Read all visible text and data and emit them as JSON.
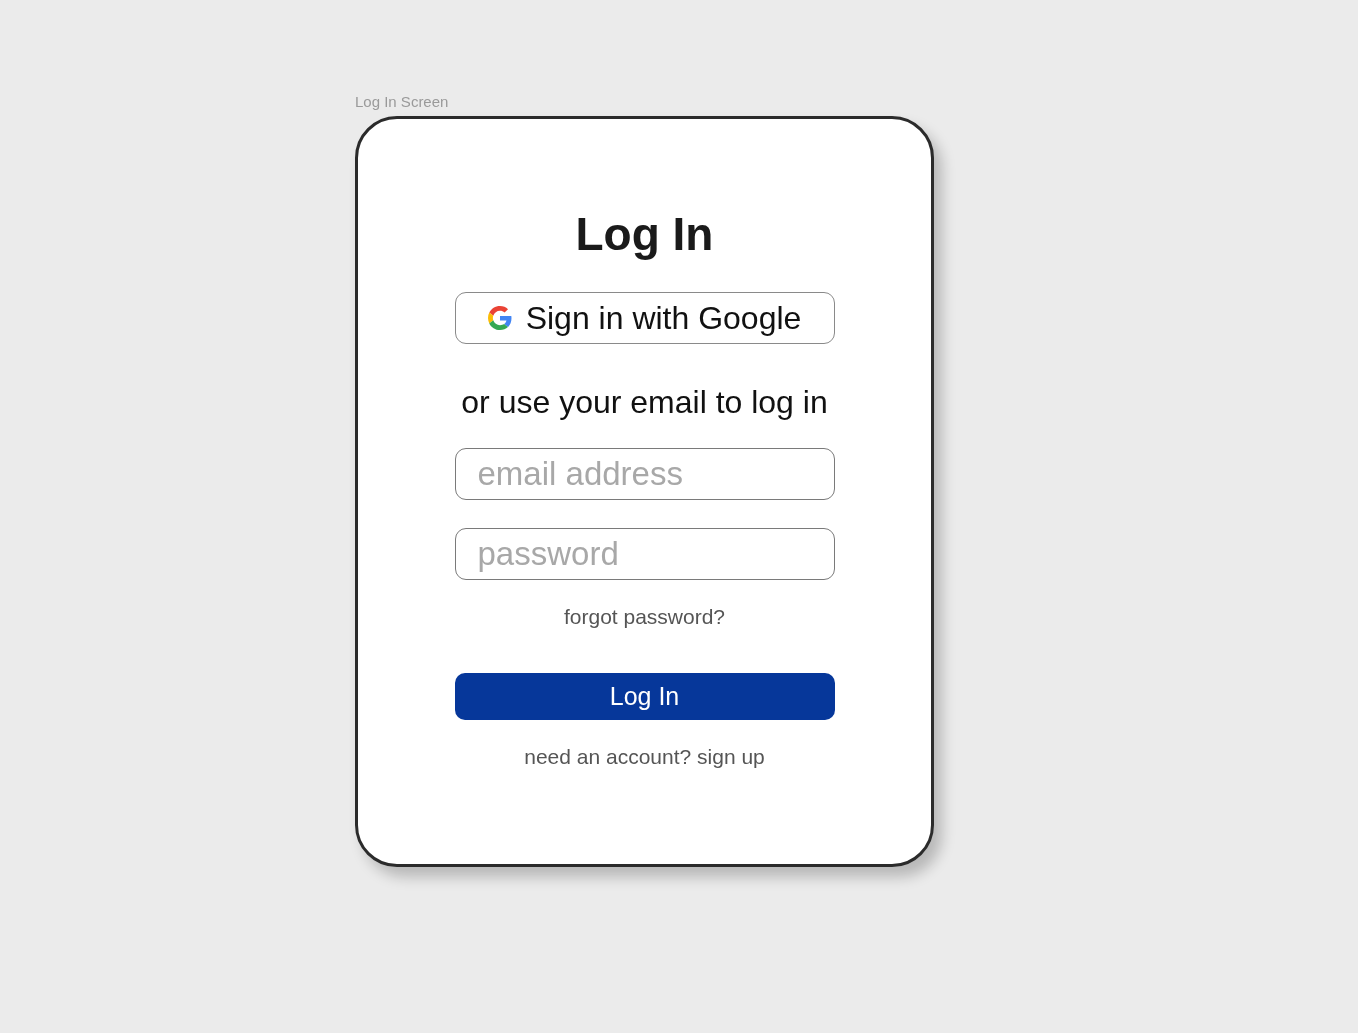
{
  "frame": {
    "label": "Log In Screen"
  },
  "card": {
    "title": "Log In",
    "google_button": {
      "label": "Sign in with Google"
    },
    "divider_text": "or use your email to log in",
    "fields": [
      {
        "placeholder": "email address"
      },
      {
        "placeholder": "password"
      }
    ],
    "forgot_link": "forgot password?",
    "submit_button": {
      "label": "Log In"
    },
    "signup_link": "need an account? sign up"
  }
}
